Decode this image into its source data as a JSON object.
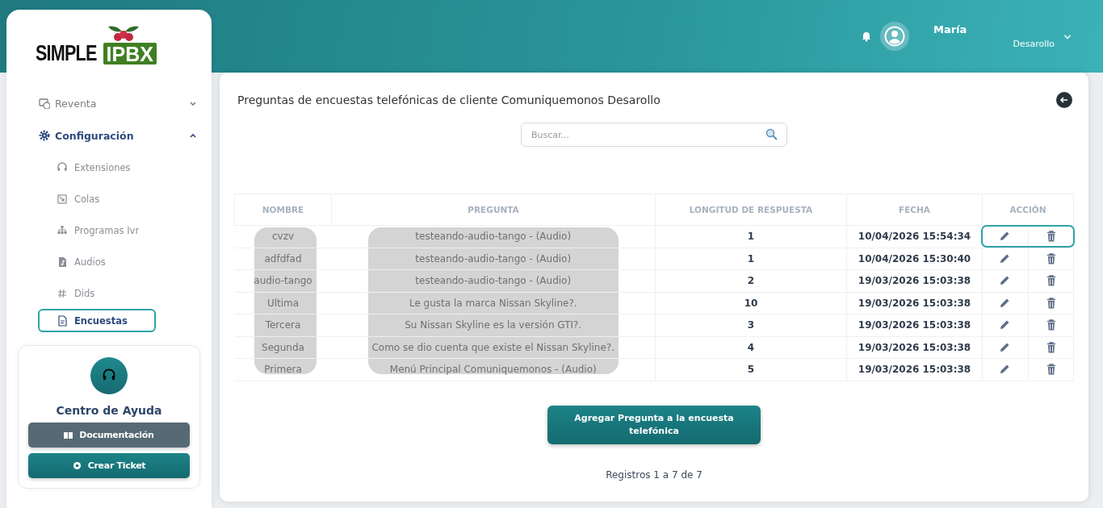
{
  "logo": {
    "word": "SIMPLE",
    "badge": "IPBX"
  },
  "user": {
    "name": "María",
    "company": "Desarollo"
  },
  "sidebar": {
    "items": [
      {
        "label": "Reventa",
        "expanded": false
      },
      {
        "label": "Configuración",
        "expanded": true,
        "children": [
          {
            "label": "Extensiones",
            "selected": false
          },
          {
            "label": "Colas",
            "selected": false
          },
          {
            "label": "Programas Ivr",
            "selected": false
          },
          {
            "label": "Audios",
            "selected": false
          },
          {
            "label": "Dids",
            "selected": false
          },
          {
            "label": "Encuestas",
            "selected": true
          }
        ]
      }
    ]
  },
  "help": {
    "title": "Centro de Ayuda",
    "buttons": [
      {
        "label": "Documentación",
        "kind": "docs"
      },
      {
        "label": "Crear Ticket",
        "kind": "ticket"
      }
    ]
  },
  "page": {
    "title": "Preguntas de encuestas telefónicas de cliente Comuniquemonos Desarollo"
  },
  "search": {
    "placeholder": "Buscar..."
  },
  "table": {
    "columns": [
      "NOMBRE",
      "PREGUNTA",
      "LONGITUD DE RESPUESTA",
      "FECHA",
      "ACCIÓN"
    ],
    "rows": [
      {
        "name": "cvzv",
        "question": "testeando-audio-tango - (Audio)",
        "length": "1",
        "date": "10/04/2026 15:54:34",
        "selected": true
      },
      {
        "name": "adfdfad",
        "question": "testeando-audio-tango - (Audio)",
        "length": "1",
        "date": "10/04/2026 15:30:40",
        "selected": false
      },
      {
        "name": "audio-tango",
        "question": "testeando-audio-tango - (Audio)",
        "length": "2",
        "date": "19/03/2026 15:03:38",
        "selected": false
      },
      {
        "name": "Ultima",
        "question": "Le gusta la marca Nissan Skyline?.",
        "length": "10",
        "date": "19/03/2026 15:03:38",
        "selected": false
      },
      {
        "name": "Tercera",
        "question": "Su Nissan Skyline es la versión GTI?.",
        "length": "3",
        "date": "19/03/2026 15:03:38",
        "selected": false
      },
      {
        "name": "Segunda",
        "question": "Como se dio cuenta que existe el Nissan Skyline?.",
        "length": "4",
        "date": "19/03/2026 15:03:38",
        "selected": false
      },
      {
        "name": "Primera",
        "question": "Menú Principal Comuniquemonos - (Audio)",
        "length": "5",
        "date": "19/03/2026 15:03:38",
        "selected": false
      }
    ]
  },
  "add_button": {
    "label": "Agregar Pregunta a la encuesta telefónica"
  },
  "footer": {
    "records": "Registros 1 a 7 de 7"
  }
}
